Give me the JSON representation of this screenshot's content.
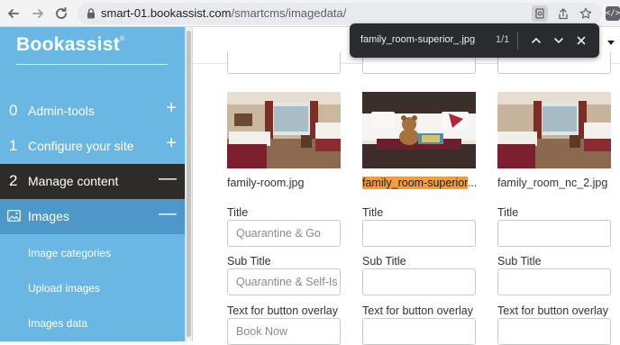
{
  "browser": {
    "url_host": "smart-01.bookassist.com",
    "url_path": "/smartcms/imagedata/"
  },
  "find_bar": {
    "query": "family_room-superior_.jpg",
    "count": "1/1"
  },
  "sidebar": {
    "brand": "Bookassist",
    "brand_mark": "®",
    "menu": [
      {
        "num": "0",
        "label": "Admin-tools",
        "sign": "+"
      },
      {
        "num": "1",
        "label": "Configure your site",
        "sign": "+"
      },
      {
        "num": "2",
        "label": "Manage content",
        "sign": "—"
      }
    ],
    "images": {
      "label": "Images",
      "sign": "—"
    },
    "sub_items": [
      "Image categories",
      "Upload images",
      "Images data"
    ]
  },
  "main": {
    "images": [
      {
        "filename": "family-room.jpg",
        "title_label": "Title",
        "title_value": "Quarantine & Go",
        "subtitle_label": "Sub Title",
        "subtitle_value": "Quarantine & Self-Is",
        "overlay_label": "Text for button overlay",
        "overlay_value": "Book Now"
      },
      {
        "filename_match": "family_room-superior",
        "filename_rest": "...",
        "title_label": "Title",
        "title_value": "",
        "subtitle_label": "Sub Title",
        "subtitle_value": "",
        "overlay_label": "Text for button overlay",
        "overlay_value": ""
      },
      {
        "filename": "family_room_nc_2.jpg",
        "title_label": "Title",
        "title_value": "",
        "subtitle_label": "Sub Title",
        "subtitle_value": "",
        "overlay_label": "Text for button overlay",
        "overlay_value": ""
      }
    ]
  },
  "colors": {
    "sidebar": "#6ab7e3",
    "sidebar_active": "#2e2c29",
    "sidebar_images": "#4d97c9",
    "find_highlight": "#f49b3a"
  }
}
